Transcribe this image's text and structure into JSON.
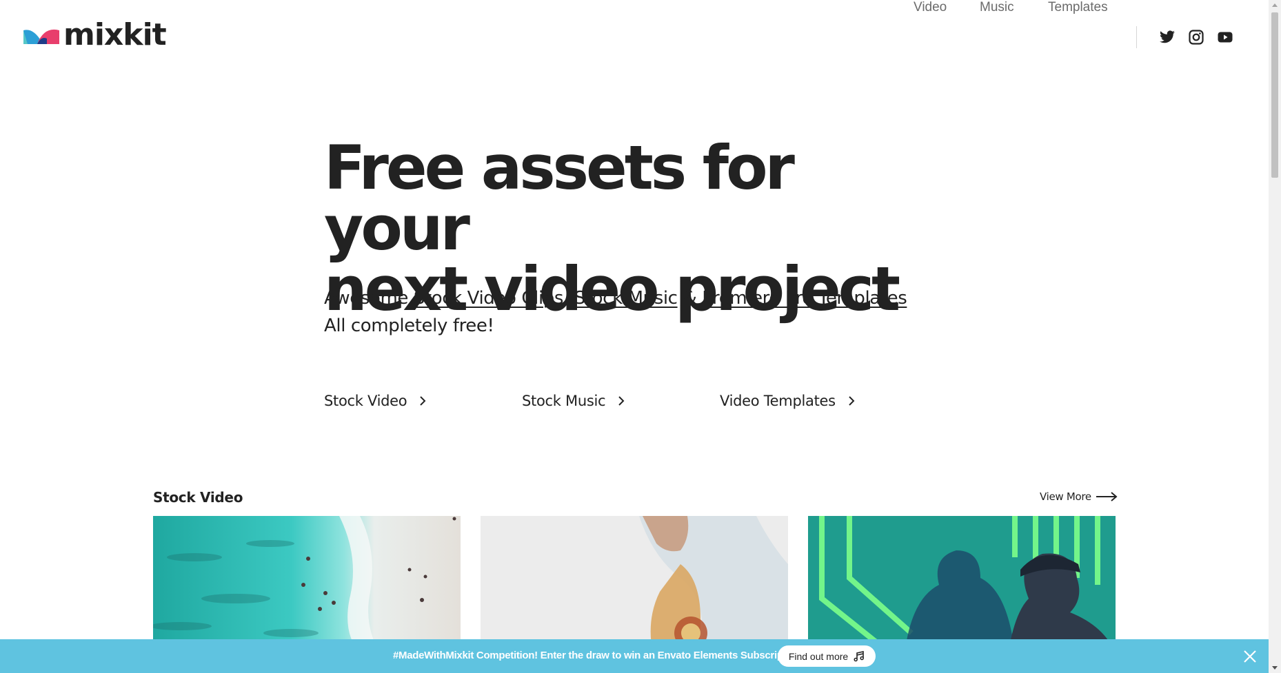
{
  "header": {
    "logo_text": "mixkit",
    "nav": [
      {
        "label": "Video"
      },
      {
        "label": "Music"
      },
      {
        "label": "Templates"
      }
    ],
    "social": [
      "twitter-icon",
      "instagram-icon",
      "youtube-icon"
    ]
  },
  "hero": {
    "title_line1": "Free assets for your",
    "title_line2": "next video project",
    "sub_prefix": "Awesome ",
    "sub_link1": "Stock Video Clips",
    "sub_sep1": ", ",
    "sub_link2": "Stock Music",
    "sub_sep2": " & ",
    "sub_link3": "Premiere Pro Templates",
    "sub_line2": "All completely free!"
  },
  "categories": [
    {
      "label": "Stock Video"
    },
    {
      "label": "Stock Music"
    },
    {
      "label": "Video Templates"
    }
  ],
  "stock_video": {
    "title": "Stock Video",
    "view_more": "View More"
  },
  "banner": {
    "text": "#MadeWithMixkit Competition! Enter the draw to win an Envato Elements Subscription.",
    "button": "Find out more"
  },
  "colors": {
    "banner": "#5fc3e0",
    "text": "#222222",
    "nav": "#6b6b6b"
  }
}
